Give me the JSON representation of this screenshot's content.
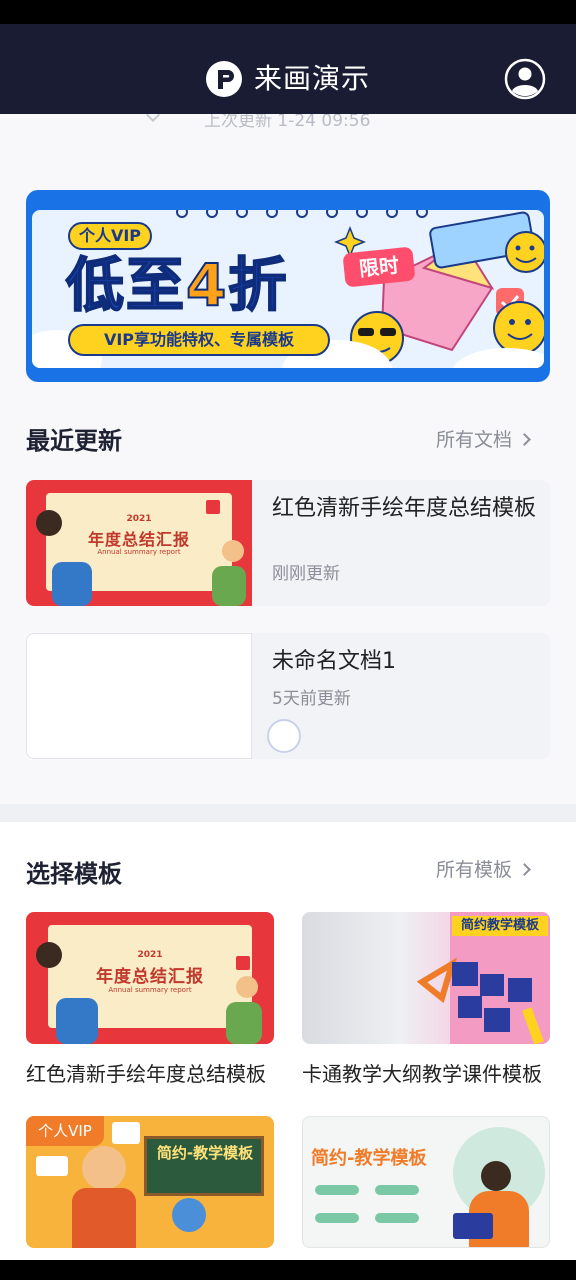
{
  "app": {
    "title": "来画演示",
    "last_updated": "上次更新 1-24 09:56"
  },
  "banner": {
    "tag": "个人VIP",
    "headline_prefix": "低至",
    "headline_number": "4",
    "headline_suffix": "折",
    "limited_badge": "限时",
    "subtitle": "VIP享功能特权、专属模板"
  },
  "recent": {
    "title": "最近更新",
    "link": "所有文档",
    "docs": [
      {
        "name": "红色清新手绘年度总结模板",
        "time": "刚刚更新",
        "thumb_year": "2021",
        "thumb_title": "年度总结汇报",
        "thumb_subtitle": "Annual summary report"
      },
      {
        "name": "未命名文档1",
        "time": "5天前更新"
      }
    ]
  },
  "templates": {
    "title": "选择模板",
    "link": "所有模板",
    "items": [
      {
        "name": "红色清新手绘年度总结模板",
        "thumb_year": "2021",
        "thumb_title": "年度总结汇报",
        "thumb_subtitle": "Annual summary report"
      },
      {
        "name": "卡通教学大纲教学课件模板",
        "thumb_title": "简约教学模板"
      },
      {
        "name": "",
        "thumb_tag": "个人VIP",
        "thumb_title": "简约-教学模板"
      },
      {
        "name": "",
        "thumb_title": "简约-教学模板"
      }
    ]
  },
  "colors": {
    "header_bg": "#191c33",
    "banner_blue": "#1a73e6",
    "accent_yellow": "#ffd21f",
    "annual_red": "#e8373c"
  },
  "icons": {
    "logo": "app-logo-icon",
    "avatar": "user-avatar-icon",
    "chevron": "chevron-right-icon"
  }
}
